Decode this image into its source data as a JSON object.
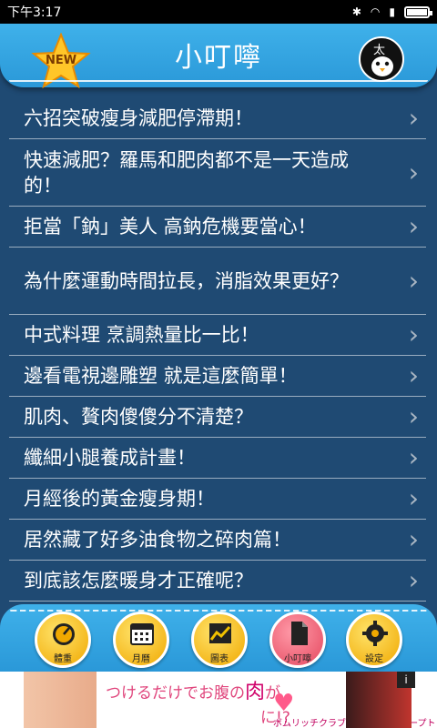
{
  "status_bar": {
    "time": "下午3:17"
  },
  "header": {
    "title": "小叮嚀",
    "new_badge": "NEW",
    "avatar_char": "太"
  },
  "articles": [
    "六招突破瘦身減肥停滯期！",
    "快速減肥？羅馬和肥肉都不是一天造成的！",
    "拒當「鈉」美人 高鈉危機要當心！",
    "為什麼運動時間拉長，消脂效果更好？",
    "中式料理 烹調熱量比一比！",
    "邊看電視邊雕塑 就是這麼簡單！",
    "肌肉、贅肉傻傻分不清楚？",
    "纖細小腿養成計畫！",
    "月經後的黃金瘦身期！",
    "居然藏了好多油食物之碎肉篇！",
    "到底該怎麼暖身才正確呢？"
  ],
  "nav": [
    {
      "label": "體重",
      "icon": "gauge-icon"
    },
    {
      "label": "月曆",
      "icon": "calendar-icon"
    },
    {
      "label": "圖表",
      "icon": "chart-icon"
    },
    {
      "label": "小叮嚀",
      "icon": "document-icon"
    },
    {
      "label": "設定",
      "icon": "gear-icon"
    }
  ],
  "ad": {
    "text_pre": "つけるだけでお腹の",
    "text_big": "肉",
    "text_post": "が",
    "text_line2": "に!?",
    "sub": "ボムリッチクラブジュアリーグループトップ",
    "info": "i"
  },
  "colors": {
    "header": "#3fb1ea",
    "background": "#1f4a73",
    "active_nav": "#e5485f",
    "nav": "#f0a800"
  }
}
